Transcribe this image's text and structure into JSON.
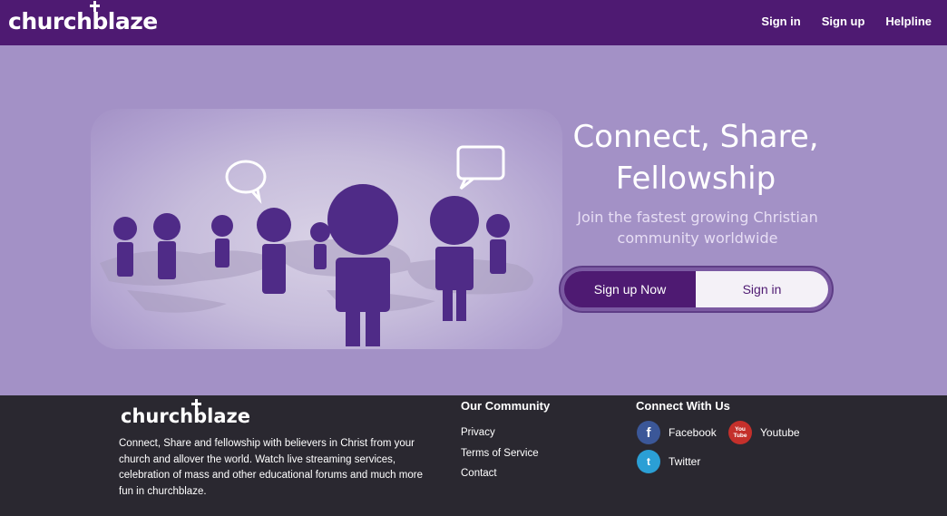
{
  "brand": {
    "name": "churchblaze",
    "name_before_cross": "church",
    "name_cross_letter": "b",
    "name_after_cross": "laze"
  },
  "nav": {
    "items": [
      "Sign in",
      "Sign up",
      "Helpline"
    ]
  },
  "hero": {
    "headline_line1": "Connect, Share,",
    "headline_line2": "Fellowship",
    "subline": "Join the fastest growing Christian community worldwide",
    "signup_button": "Sign up Now",
    "signin_button": "Sign in"
  },
  "footer": {
    "about": "Connect, Share and fellowship with believers in Christ from your church and allover the world. Watch live streaming services, celebration of mass and other educational forums and much more fun in churchblaze.",
    "community_title": "Our Community",
    "community_links": [
      "Privacy",
      "Terms of Service",
      "Contact"
    ],
    "connect_title": "Connect With Us",
    "social": [
      {
        "label": "Facebook",
        "icon": "facebook-icon",
        "icon_text": "f"
      },
      {
        "label": "Youtube",
        "icon": "youtube-icon",
        "icon_text_1": "You",
        "icon_text_2": "Tube"
      },
      {
        "label": "Twitter",
        "icon": "twitter-icon",
        "icon_text": "t"
      }
    ]
  },
  "colors": {
    "nav_bg": "#4e1a72",
    "hero_bg": "#a391c6",
    "footer_bg": "#2a2830",
    "figure": "#4f2b87"
  }
}
